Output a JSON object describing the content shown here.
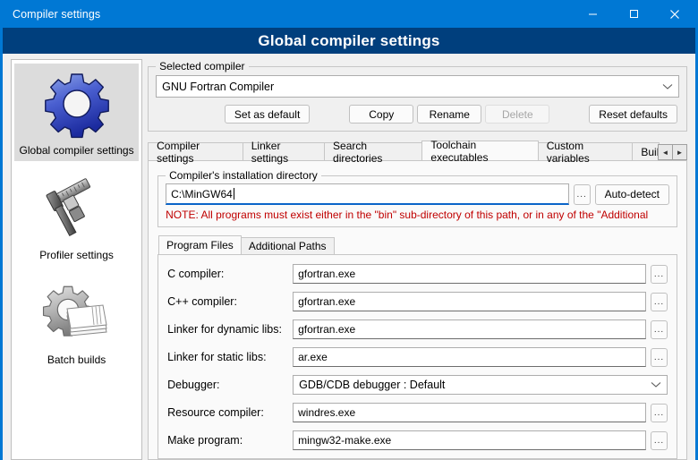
{
  "window": {
    "title": "Compiler settings",
    "controls": {
      "minimize": "minimize-icon",
      "maximize": "maximize-icon",
      "close": "close-icon"
    },
    "accent_color": "#0078d4",
    "header_color": "#003f7d"
  },
  "header": {
    "title": "Global compiler settings"
  },
  "sidebar": {
    "items": [
      {
        "label": "Global compiler settings",
        "icon": "blue-gear-icon",
        "selected": true
      },
      {
        "label": "Profiler settings",
        "icon": "caliper-icon",
        "selected": false
      },
      {
        "label": "Batch builds",
        "icon": "gear-pages-icon",
        "selected": false
      }
    ]
  },
  "selected_compiler": {
    "group_title": "Selected compiler",
    "value": "GNU Fortran Compiler",
    "dropdown_icon": "chevron-down-icon",
    "buttons": [
      {
        "label": "Set as default",
        "enabled": true
      },
      {
        "label": "Copy",
        "enabled": true
      },
      {
        "label": "Rename",
        "enabled": true
      },
      {
        "label": "Delete",
        "enabled": false
      },
      {
        "label": "Reset defaults",
        "enabled": true
      }
    ]
  },
  "tabs": {
    "items": [
      {
        "label": "Compiler settings",
        "active": false
      },
      {
        "label": "Linker settings",
        "active": false
      },
      {
        "label": "Search directories",
        "active": false
      },
      {
        "label": "Toolchain executables",
        "active": true
      },
      {
        "label": "Custom variables",
        "active": false
      },
      {
        "label": "Build",
        "active": false
      }
    ],
    "scroll_left": "◄",
    "scroll_right": "►"
  },
  "install_dir": {
    "group_title": "Compiler's installation directory",
    "value": "C:\\MinGW64",
    "browse_label": "...",
    "autodetect_label": "Auto-detect",
    "note": "NOTE: All programs must exist either in the \"bin\" sub-directory of this path, or in any of the \"Additional",
    "note_color": "#c00000"
  },
  "inner_tabs": [
    {
      "label": "Program Files",
      "active": true
    },
    {
      "label": "Additional Paths",
      "active": false
    }
  ],
  "program_files": {
    "browse_label": "...",
    "dropdown_icon": "chevron-down-icon",
    "rows": [
      {
        "label": "C compiler:",
        "value": "gfortran.exe",
        "type": "text"
      },
      {
        "label": "C++ compiler:",
        "value": "gfortran.exe",
        "type": "text"
      },
      {
        "label": "Linker for dynamic libs:",
        "value": "gfortran.exe",
        "type": "text"
      },
      {
        "label": "Linker for static libs:",
        "value": "ar.exe",
        "type": "text"
      },
      {
        "label": "Debugger:",
        "value": "GDB/CDB debugger : Default",
        "type": "combo"
      },
      {
        "label": "Resource compiler:",
        "value": "windres.exe",
        "type": "text"
      },
      {
        "label": "Make program:",
        "value": "mingw32-make.exe",
        "type": "text"
      }
    ]
  }
}
